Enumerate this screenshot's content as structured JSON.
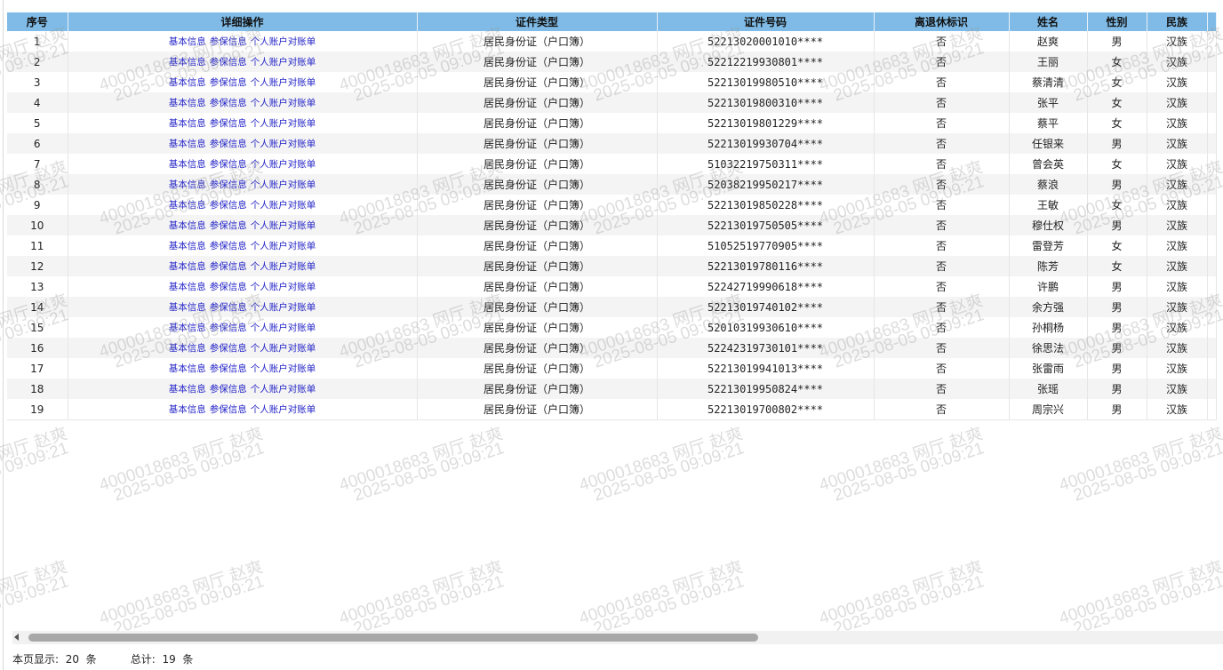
{
  "table": {
    "headers": [
      "序号",
      "详细操作",
      "证件类型",
      "证件号码",
      "离退休标识",
      "姓名",
      "性别",
      "民族"
    ],
    "operations": [
      "基本信息",
      "参保信息",
      "个人账户对账单"
    ],
    "rows": [
      {
        "no": "1",
        "id_type": "居民身份证（户口簿）",
        "id_no": "52213020001010****",
        "retired": "否",
        "name": "赵爽",
        "gender": "男",
        "ethnic": "汉族"
      },
      {
        "no": "2",
        "id_type": "居民身份证（户口簿）",
        "id_no": "52212219930801****",
        "retired": "否",
        "name": "王丽",
        "gender": "女",
        "ethnic": "汉族"
      },
      {
        "no": "3",
        "id_type": "居民身份证（户口簿）",
        "id_no": "52213019980510****",
        "retired": "否",
        "name": "蔡清清",
        "gender": "女",
        "ethnic": "汉族"
      },
      {
        "no": "4",
        "id_type": "居民身份证（户口簿）",
        "id_no": "52213019800310****",
        "retired": "否",
        "name": "张平",
        "gender": "女",
        "ethnic": "汉族"
      },
      {
        "no": "5",
        "id_type": "居民身份证（户口簿）",
        "id_no": "52213019801229****",
        "retired": "否",
        "name": "蔡平",
        "gender": "女",
        "ethnic": "汉族"
      },
      {
        "no": "6",
        "id_type": "居民身份证（户口簿）",
        "id_no": "52213019930704****",
        "retired": "否",
        "name": "任银来",
        "gender": "男",
        "ethnic": "汉族"
      },
      {
        "no": "7",
        "id_type": "居民身份证（户口簿）",
        "id_no": "51032219750311****",
        "retired": "否",
        "name": "曾会英",
        "gender": "女",
        "ethnic": "汉族"
      },
      {
        "no": "8",
        "id_type": "居民身份证（户口簿）",
        "id_no": "52038219950217****",
        "retired": "否",
        "name": "蔡浪",
        "gender": "男",
        "ethnic": "汉族"
      },
      {
        "no": "9",
        "id_type": "居民身份证（户口簿）",
        "id_no": "52213019850228****",
        "retired": "否",
        "name": "王敏",
        "gender": "女",
        "ethnic": "汉族"
      },
      {
        "no": "10",
        "id_type": "居民身份证（户口簿）",
        "id_no": "52213019750505****",
        "retired": "否",
        "name": "穆仕权",
        "gender": "男",
        "ethnic": "汉族"
      },
      {
        "no": "11",
        "id_type": "居民身份证（户口簿）",
        "id_no": "51052519770905****",
        "retired": "否",
        "name": "雷登芳",
        "gender": "女",
        "ethnic": "汉族"
      },
      {
        "no": "12",
        "id_type": "居民身份证（户口簿）",
        "id_no": "52213019780116****",
        "retired": "否",
        "name": "陈芳",
        "gender": "女",
        "ethnic": "汉族"
      },
      {
        "no": "13",
        "id_type": "居民身份证（户口簿）",
        "id_no": "52242719990618****",
        "retired": "否",
        "name": "许鹏",
        "gender": "男",
        "ethnic": "汉族"
      },
      {
        "no": "14",
        "id_type": "居民身份证（户口簿）",
        "id_no": "52213019740102****",
        "retired": "否",
        "name": "余方强",
        "gender": "男",
        "ethnic": "汉族"
      },
      {
        "no": "15",
        "id_type": "居民身份证（户口簿）",
        "id_no": "52010319930610****",
        "retired": "否",
        "name": "孙桐杨",
        "gender": "男",
        "ethnic": "汉族"
      },
      {
        "no": "16",
        "id_type": "居民身份证（户口簿）",
        "id_no": "52242319730101****",
        "retired": "否",
        "name": "徐思法",
        "gender": "男",
        "ethnic": "汉族"
      },
      {
        "no": "17",
        "id_type": "居民身份证（户口簿）",
        "id_no": "52213019941013****",
        "retired": "否",
        "name": "张雷雨",
        "gender": "男",
        "ethnic": "汉族"
      },
      {
        "no": "18",
        "id_type": "居民身份证（户口簿）",
        "id_no": "52213019950824****",
        "retired": "否",
        "name": "张瑶",
        "gender": "男",
        "ethnic": "汉族"
      },
      {
        "no": "19",
        "id_type": "居民身份证（户口簿）",
        "id_no": "52213019700802****",
        "retired": "否",
        "name": "周宗兴",
        "gender": "男",
        "ethnic": "汉族"
      }
    ]
  },
  "watermark": {
    "line1": "4000018683 网厅 赵爽",
    "line2": "2025-08-05 09:09:21"
  },
  "footer": {
    "page_label": "本页显示:",
    "page_count": "20",
    "page_unit": "条",
    "total_label": "总计:",
    "total_count": "19",
    "total_unit": "条"
  },
  "scrollbar": {
    "horizontal_position": 0.0,
    "visible_fraction": 0.61
  },
  "colors": {
    "header_bg": "#7fbbe6",
    "link": "#2323c8",
    "row_alt": "#f4f4f4"
  }
}
